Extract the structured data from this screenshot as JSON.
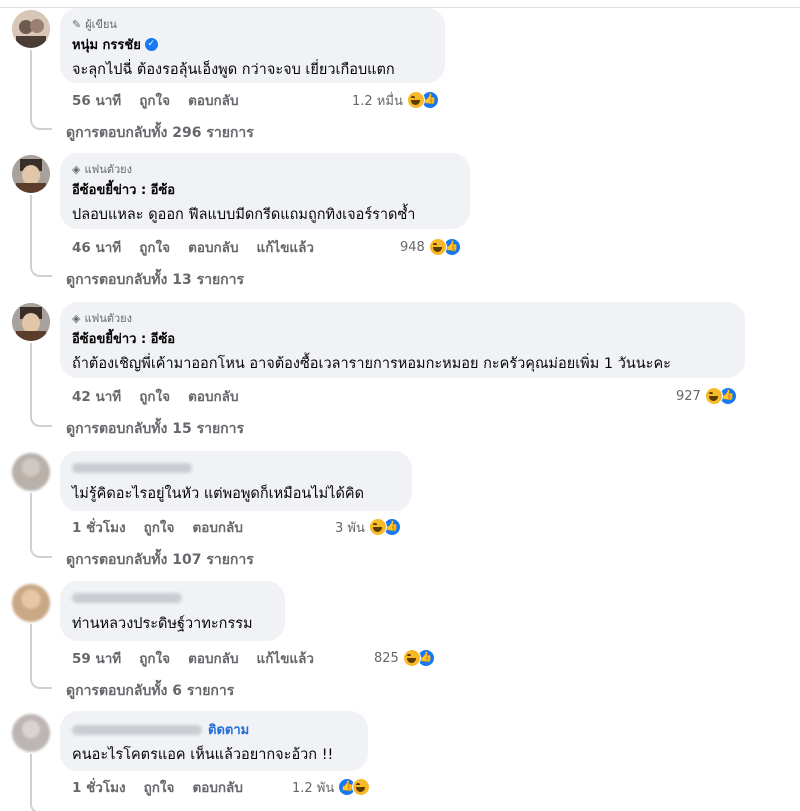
{
  "comments": [
    {
      "badge": "ผู้เขียน",
      "name": "หนุ่ม กรรชัย",
      "text": "จะลุกไปฉี่ ต้องรอลุ้นเอ็งพูด กว่าจะจบ เยี่ยวเกือบแตก",
      "time": "56 นาที",
      "like": "ถูกใจ",
      "reply": "ตอบกลับ",
      "edited": "",
      "reactions": "1.2 หมื่น",
      "view_replies": "ดูการตอบกลับทั้ง 296 รายการ"
    },
    {
      "badge": "แฟนตัวยง",
      "name": "อีซ้อขยี้ข่าว : อีซ้อ",
      "text": "ปลอบแหละ ดูออก ฟีลแบบมีดกรีดแถมถูกทิงเจอร์ราดซ้ำ",
      "time": "46 นาที",
      "like": "ถูกใจ",
      "reply": "ตอบกลับ",
      "edited": "แก้ไขแล้ว",
      "reactions": "948",
      "view_replies": "ดูการตอบกลับทั้ง 13 รายการ"
    },
    {
      "badge": "แฟนตัวยง",
      "name": "อีซ้อขยี้ข่าว : อีซ้อ",
      "text": "ถ้าต้องเชิญพี่เค้ามาออกโหน อาจต้องซื้อเวลารายการหอมกะหมอย กะครัวคุณม่อยเพิ่ม 1 วันนะคะ",
      "time": "42 นาที",
      "like": "ถูกใจ",
      "reply": "ตอบกลับ",
      "edited": "",
      "reactions": "927",
      "view_replies": "ดูการตอบกลับทั้ง 15 รายการ"
    },
    {
      "badge": "",
      "name": "",
      "text": "ไม่รู้คิดอะไรอยู่ในหัว แต่พอพูดก็เหมือนไม่ได้คิด",
      "time": "1 ชั่วโมง",
      "like": "ถูกใจ",
      "reply": "ตอบกลับ",
      "edited": "",
      "reactions": "3 พัน",
      "view_replies": "ดูการตอบกลับทั้ง 107 รายการ"
    },
    {
      "badge": "",
      "name": "",
      "text": "ท่านหลวงประดิษฐ์วาทะกรรม",
      "time": "59 นาที",
      "like": "ถูกใจ",
      "reply": "ตอบกลับ",
      "edited": "แก้ไขแล้ว",
      "reactions": "825",
      "view_replies": "ดูการตอบกลับทั้ง 6 รายการ"
    },
    {
      "badge": "",
      "name": "",
      "follow": "ติดตาม",
      "text": "คนอะไรโคตรแอค เห็นแล้วอยากจะอ้วก !!",
      "time": "1 ชั่วโมง",
      "like": "ถูกใจ",
      "reply": "ตอบกลับ",
      "edited": "",
      "reactions": "1.2 พัน",
      "view_replies": ""
    }
  ],
  "colors": {
    "bubble": "#f0f2f5",
    "meta_text": "#65676b",
    "link_blue": "#216fdb",
    "like_blue": "#1877f2",
    "haha_yellow": "#f7b928"
  },
  "icons": {
    "author_badge": "pencil-icon",
    "fan_badge": "diamond-icon",
    "verified": "verified-badge-icon",
    "reaction_haha": "haha-reaction-icon",
    "reaction_like": "like-reaction-icon"
  }
}
